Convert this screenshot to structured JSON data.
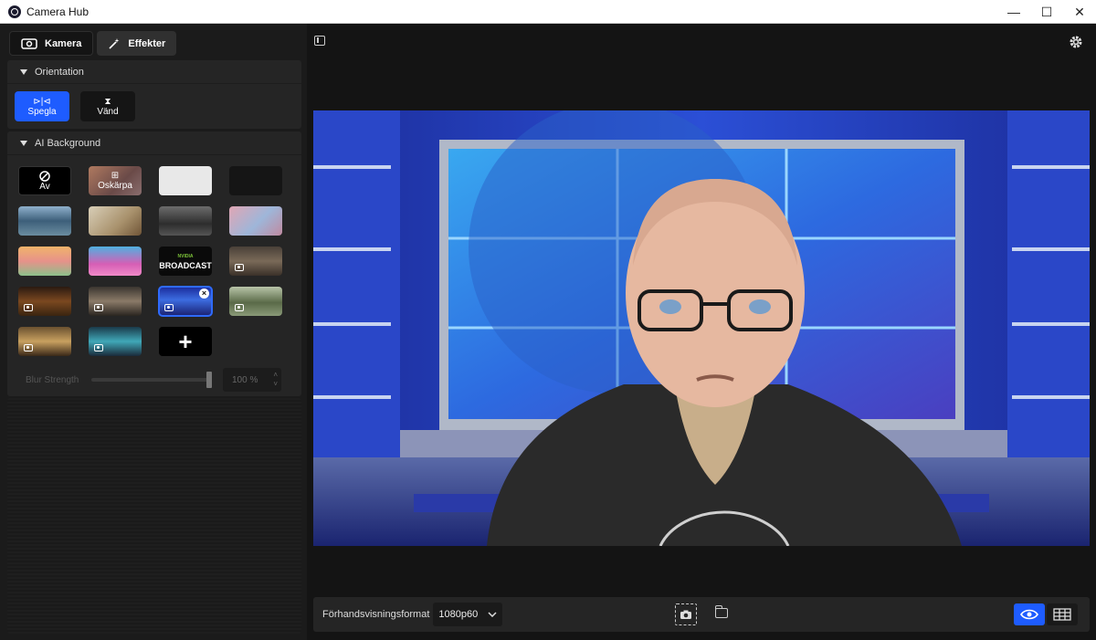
{
  "window": {
    "title": "Camera Hub",
    "controls": [
      "—",
      "☐",
      "✕"
    ]
  },
  "tabs": [
    {
      "label": "Kamera",
      "icon": "camera-icon",
      "active": true
    },
    {
      "label": "Effekter",
      "icon": "magic-wand-icon",
      "active": false
    }
  ],
  "orientation": {
    "title": "Orientation",
    "buttons": [
      {
        "label": "Spegla",
        "icon": "mirror-icon",
        "active": true
      },
      {
        "label": "Vänd",
        "icon": "flip-icon",
        "active": false
      }
    ]
  },
  "ai_background": {
    "title": "AI Background",
    "tiles": [
      {
        "label": "Av",
        "kind": "none"
      },
      {
        "label": "Oskärpa",
        "kind": "blur"
      },
      {
        "label": "",
        "kind": "white"
      },
      {
        "label": "",
        "kind": "dark"
      },
      {
        "label": "",
        "kind": "room-blue"
      },
      {
        "label": "",
        "kind": "room-wood"
      },
      {
        "label": "",
        "kind": "office"
      },
      {
        "label": "",
        "kind": "anime-city"
      },
      {
        "label": "",
        "kind": "anime-room"
      },
      {
        "label": "",
        "kind": "anime-pink"
      },
      {
        "label": "",
        "kind": "nvidia-broadcast",
        "logo_small": "NVIDIA",
        "logo": "BROADCAST"
      },
      {
        "label": "",
        "kind": "lounge-video"
      },
      {
        "label": "",
        "kind": "cafe-video"
      },
      {
        "label": "",
        "kind": "bar-video"
      },
      {
        "label": "",
        "kind": "news-studio-video",
        "selected": true
      },
      {
        "label": "",
        "kind": "plants-video"
      },
      {
        "label": "",
        "kind": "window-video"
      },
      {
        "label": "",
        "kind": "studio-teal-video"
      },
      {
        "label": "+",
        "kind": "add"
      }
    ],
    "blur_strength": {
      "label": "Blur Strength",
      "value": "100 %"
    }
  },
  "bottom_bar": {
    "format_label": "Förhandsvisningsformat",
    "format_value": "1080p60"
  },
  "colors": {
    "accent": "#1e5cff",
    "panel": "#252525",
    "background": "#141414"
  }
}
